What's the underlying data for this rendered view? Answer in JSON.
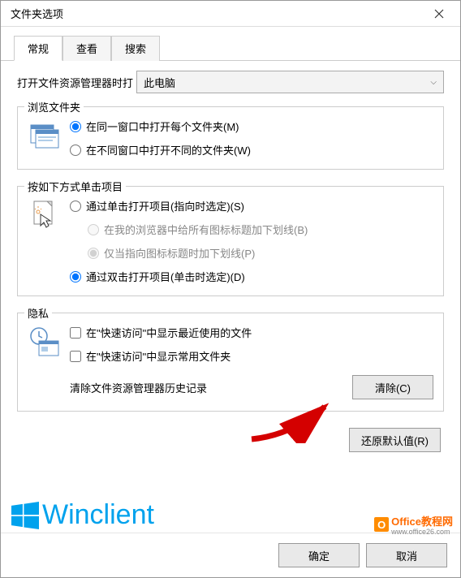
{
  "window": {
    "title": "文件夹选项"
  },
  "tabs": {
    "general": "常规",
    "view": "查看",
    "search": "搜索"
  },
  "openExplorer": {
    "label": "打开文件资源管理器时打",
    "value": "此电脑"
  },
  "browseFolders": {
    "legend": "浏览文件夹",
    "opt1": "在同一窗口中打开每个文件夹(M)",
    "opt2": "在不同窗口中打开不同的文件夹(W)"
  },
  "clickItems": {
    "legend": "按如下方式单击项目",
    "opt1": "通过单击打开项目(指向时选定)(S)",
    "sub1": "在我的浏览器中给所有图标标题加下划线(B)",
    "sub2": "仅当指向图标标题时加下划线(P)",
    "opt2": "通过双击打开项目(单击时选定)(D)"
  },
  "privacy": {
    "legend": "隐私",
    "chk1": "在\"快速访问\"中显示最近使用的文件",
    "chk2": "在\"快速访问\"中显示常用文件夹",
    "clearLabel": "清除文件资源管理器历史记录",
    "clearBtn": "清除(C)"
  },
  "restoreBtn": "还原默认值(R)",
  "bottom": {
    "ok": "确定",
    "cancel": "取消"
  },
  "watermarks": {
    "w1": "Winclient",
    "w2_main": "Office教程网",
    "w2_sub": "www.office26.com"
  }
}
